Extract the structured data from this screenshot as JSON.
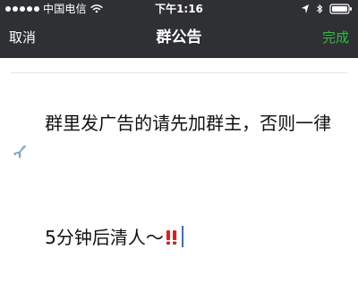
{
  "status_bar": {
    "carrier": "中国电信",
    "time": "下午1:16"
  },
  "nav": {
    "cancel_label": "取消",
    "title": "群公告",
    "done_label": "完成",
    "done_color": "#23c23b"
  },
  "editor": {
    "line1": "群里发广告的请先加群主，否则一律",
    "line2": "5分钟后清人～"
  },
  "icons": {
    "status_left": [
      "signal-icon",
      "wifi-icon"
    ],
    "status_right": [
      "location-icon",
      "bluetooth-icon",
      "battery-icon"
    ],
    "inline": [
      "airplane-icon",
      "double-exclamation-icon"
    ]
  }
}
